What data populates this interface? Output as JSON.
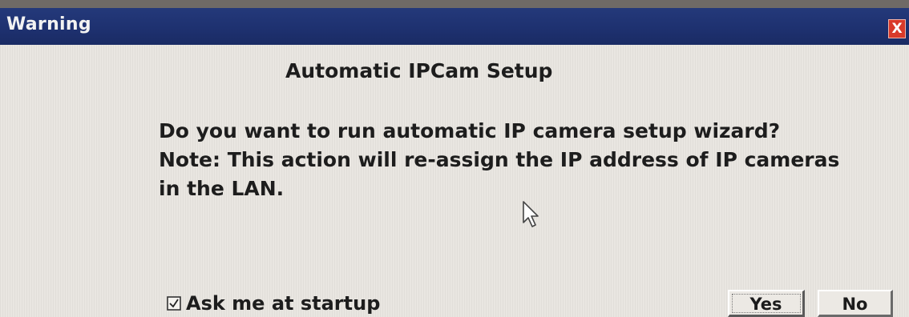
{
  "window": {
    "title": "Warning",
    "close_label": "X"
  },
  "dialog": {
    "heading": "Automatic IPCam Setup",
    "message_lines": [
      "Do you want to run automatic IP camera setup wizard?",
      "Note: This action will re-assign the IP address of IP cameras",
      "in the LAN."
    ]
  },
  "footer": {
    "checkbox_label": "Ask me at startup",
    "checkbox_checked": true,
    "yes_label": "Yes",
    "no_label": "No"
  },
  "icons": {
    "checkbox": "checkmark-icon",
    "cursor": "mouse-pointer-icon"
  },
  "colors": {
    "titlebar": "#1e3170",
    "close_button": "#d93a2a",
    "dialog_background": "#e9e6e1"
  }
}
